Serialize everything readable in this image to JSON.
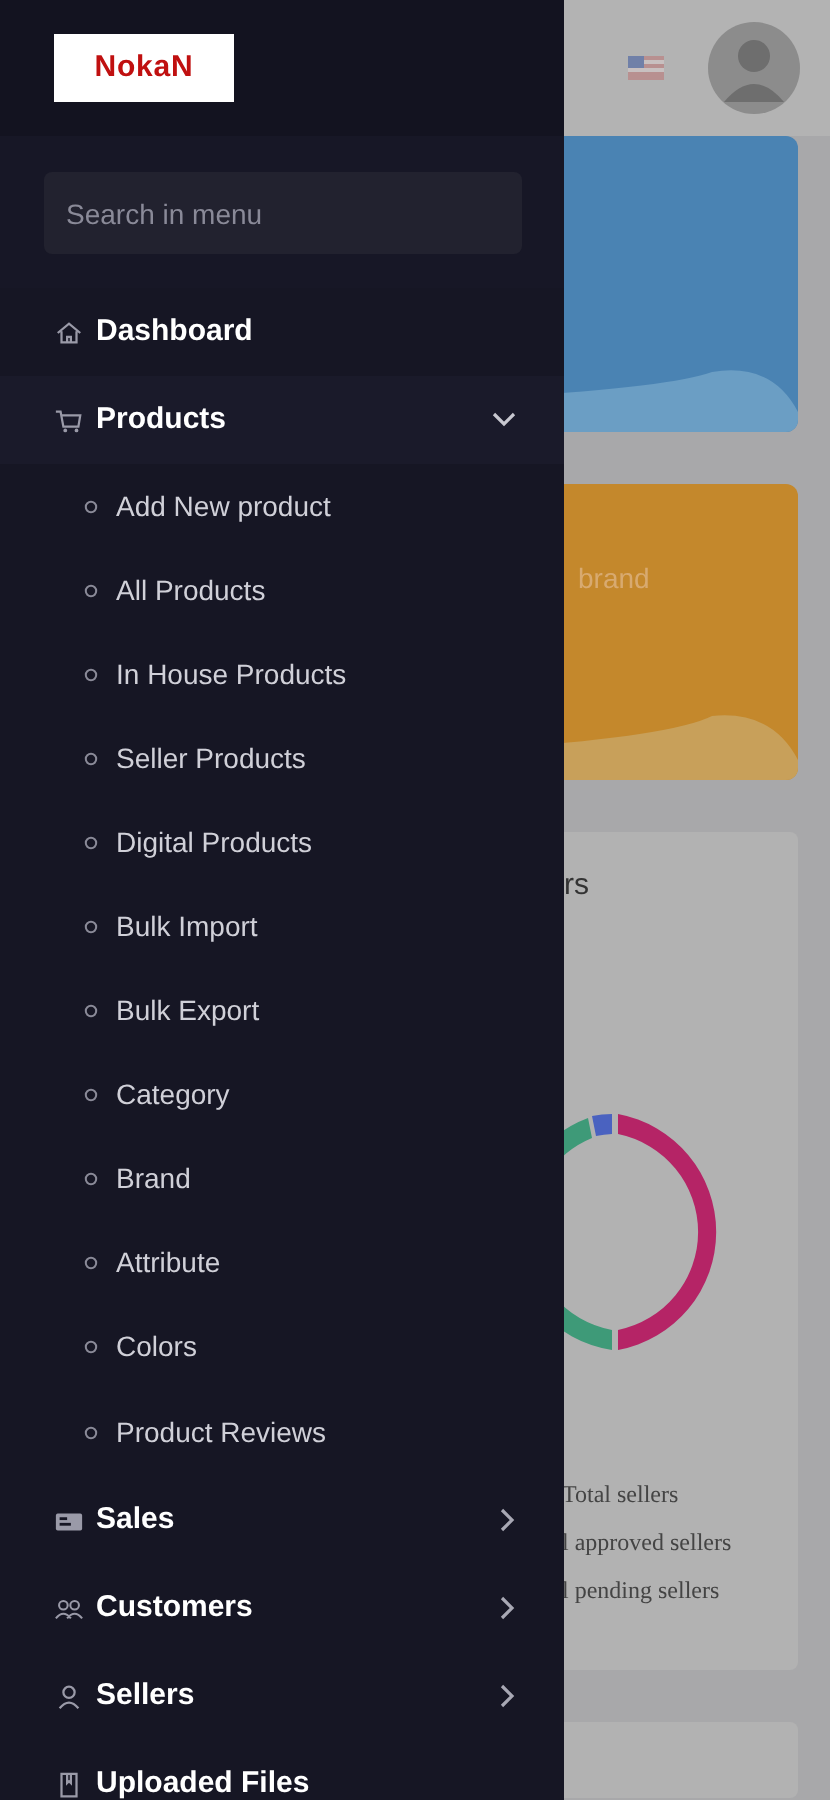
{
  "sidebar": {
    "logo": "NokaN",
    "search": {
      "placeholder": "Search in menu"
    },
    "items": [
      {
        "label": "Dashboard"
      },
      {
        "label": "Products",
        "expanded": true,
        "children": [
          {
            "label": "Add New product"
          },
          {
            "label": "All Products"
          },
          {
            "label": "In House Products"
          },
          {
            "label": "Seller Products"
          },
          {
            "label": "Digital Products"
          },
          {
            "label": "Bulk Import"
          },
          {
            "label": "Bulk Export"
          },
          {
            "label": "Category"
          },
          {
            "label": "Brand"
          },
          {
            "label": "Attribute"
          },
          {
            "label": "Colors"
          },
          {
            "label": "Product Reviews"
          }
        ]
      },
      {
        "label": "Sales",
        "expanded": false
      },
      {
        "label": "Customers",
        "expanded": false
      },
      {
        "label": "Sellers",
        "expanded": false
      },
      {
        "label": "Uploaded Files"
      }
    ]
  },
  "main": {
    "brand_card_text": "brand",
    "sellers_card": {
      "title": "rs",
      "legend": [
        "Total sellers",
        "l approved sellers",
        "l pending sellers"
      ]
    }
  }
}
